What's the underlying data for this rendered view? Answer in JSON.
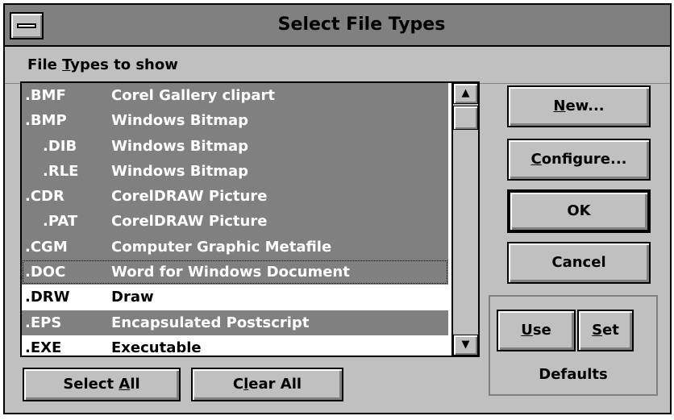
{
  "dialog": {
    "title": "Select File Types",
    "sysmenu_icon": "system-menu-icon"
  },
  "file_types": {
    "label_pre": "File ",
    "label_mnemonic": "T",
    "label_post": "ypes to show",
    "rows": [
      {
        "ext": ".BMF",
        "desc": "Corel Gallery clipart",
        "selected": true,
        "indent": false
      },
      {
        "ext": ".BMP",
        "desc": "Windows Bitmap",
        "selected": true,
        "indent": false
      },
      {
        "ext": ".DIB",
        "desc": "Windows Bitmap",
        "selected": true,
        "indent": true
      },
      {
        "ext": ".RLE",
        "desc": "Windows Bitmap",
        "selected": true,
        "indent": true
      },
      {
        "ext": ".CDR",
        "desc": "CorelDRAW Picture",
        "selected": true,
        "indent": false
      },
      {
        "ext": ".PAT",
        "desc": "CorelDRAW Picture",
        "selected": true,
        "indent": true
      },
      {
        "ext": ".CGM",
        "desc": "Computer Graphic Metafile",
        "selected": true,
        "indent": false
      },
      {
        "ext": ".DOC",
        "desc": "Word for Windows Document",
        "selected": true,
        "indent": false,
        "focused": true
      },
      {
        "ext": ".DRW",
        "desc": "Draw",
        "selected": false,
        "indent": false
      },
      {
        "ext": ".EPS",
        "desc": "Encapsulated Postscript",
        "selected": true,
        "indent": false
      },
      {
        "ext": ".EXE",
        "desc": "Executable",
        "selected": false,
        "indent": false
      }
    ]
  },
  "scrollbar": {
    "up_icon": "scroll-up-arrow-icon",
    "down_icon": "scroll-down-arrow-icon",
    "up_glyph": "▲",
    "down_glyph": "▼"
  },
  "buttons": {
    "new": {
      "pre": "",
      "mn": "N",
      "post": "ew..."
    },
    "configure": {
      "pre": "",
      "mn": "C",
      "post": "onfigure..."
    },
    "ok": {
      "pre": "OK",
      "mn": "",
      "post": ""
    },
    "cancel": {
      "pre": "Cancel",
      "mn": "",
      "post": ""
    },
    "use": {
      "pre": "",
      "mn": "U",
      "post": "se"
    },
    "set": {
      "pre": "",
      "mn": "S",
      "post": "et"
    },
    "select_all": {
      "pre": "Select ",
      "mn": "A",
      "post": "ll"
    },
    "clear_all": {
      "pre": "C",
      "mn": "l",
      "post": "ear All"
    }
  },
  "defaults": {
    "label": "Defaults"
  },
  "colors": {
    "face": "#c0c0c0",
    "shadow": "#808080",
    "highlight": "#ffffff",
    "selection": "#808080"
  }
}
